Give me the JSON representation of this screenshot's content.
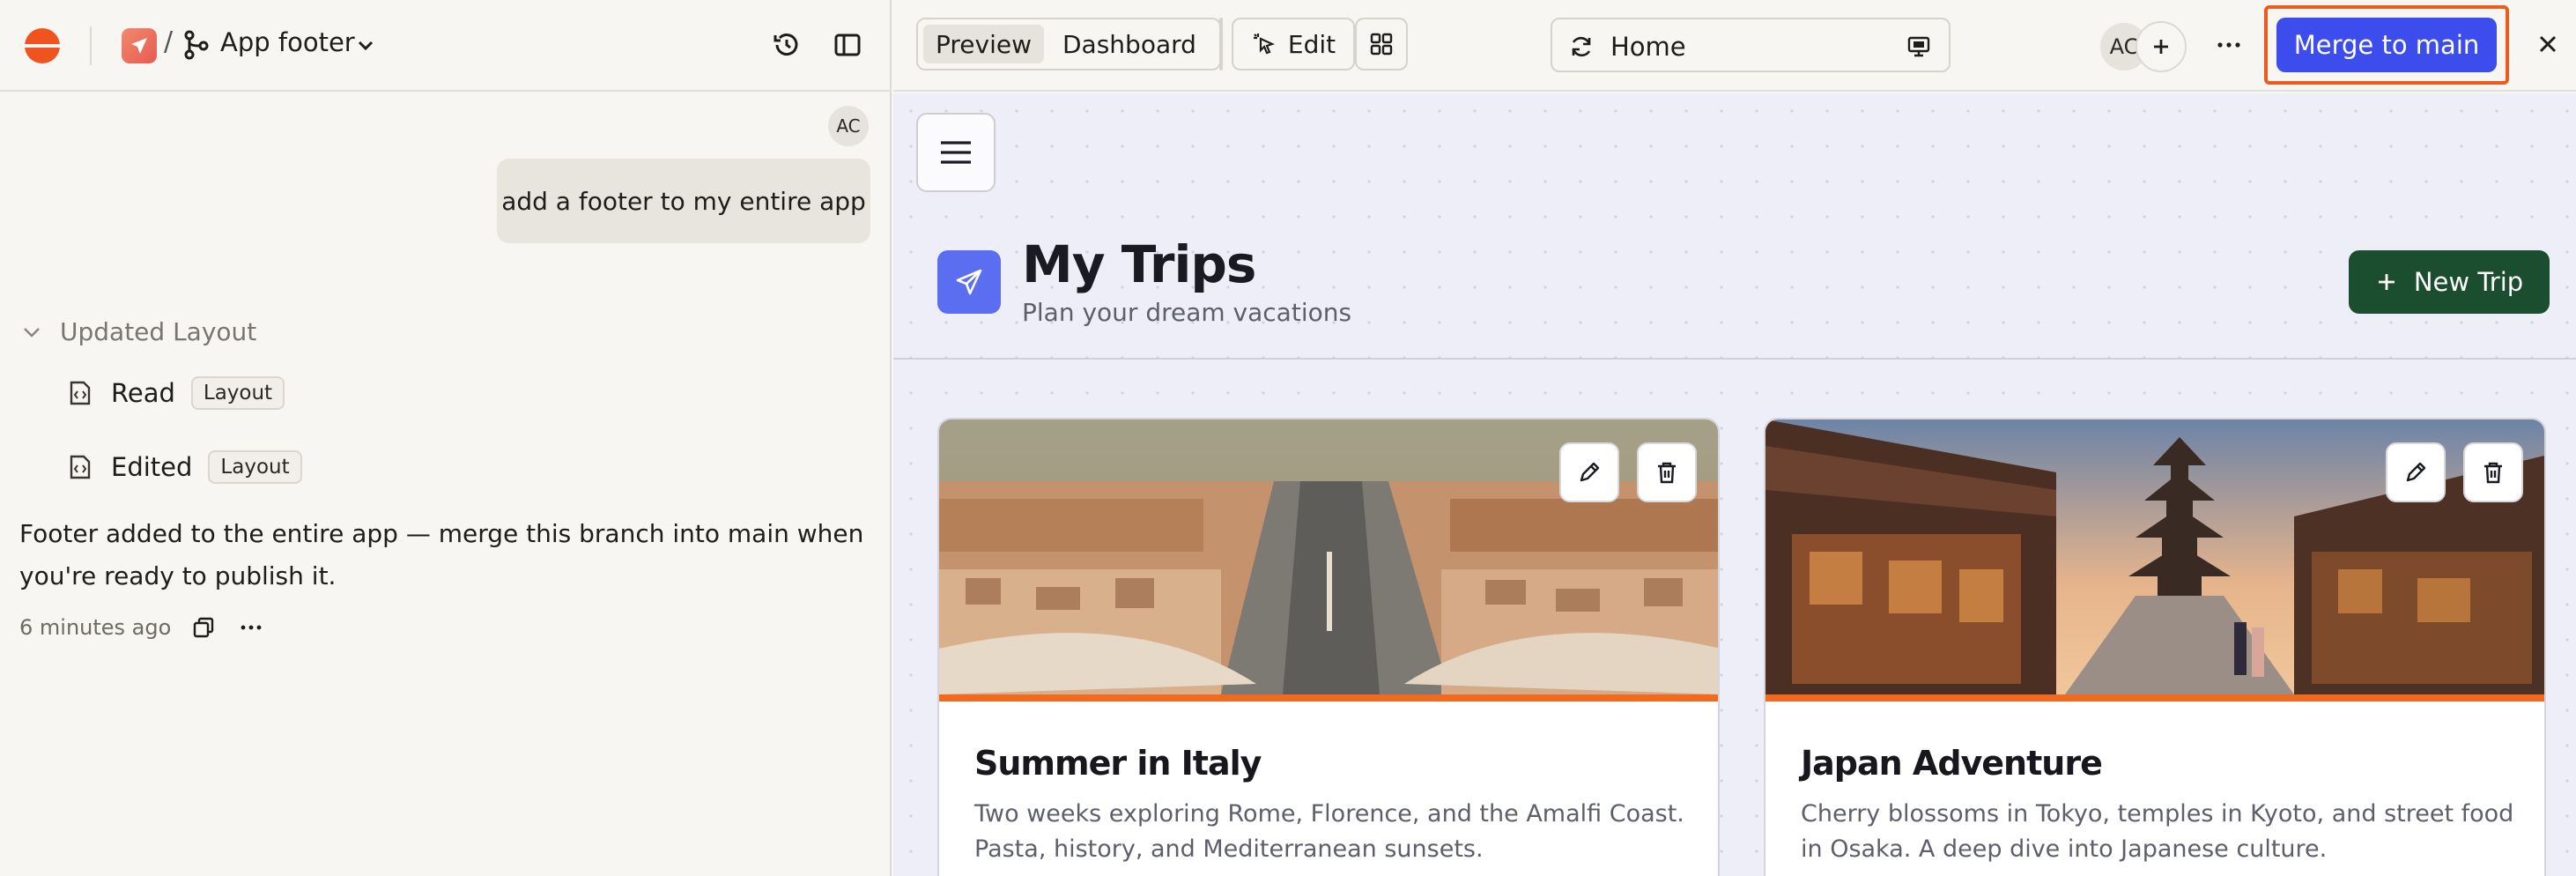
{
  "branch": {
    "name": "App footer"
  },
  "chat": {
    "user_avatar": "AC",
    "user_message": "add a footer to my entire app",
    "section_label": "Updated Layout",
    "tools": [
      {
        "action": "Read",
        "tag": "Layout"
      },
      {
        "action": "Edited",
        "tag": "Layout"
      }
    ],
    "reply": "Footer added to the entire app — merge this branch into main when you're ready to publish it.",
    "timestamp": "6 minutes ago"
  },
  "toolbar": {
    "preview_label": "Preview",
    "dashboard_label": "Dashboard",
    "edit_label": "Edit",
    "url_text": "Home",
    "collaborator_initials": "AC",
    "merge_label": "Merge to main"
  },
  "app": {
    "title": "My Trips",
    "subtitle": "Plan your dream vacations",
    "new_trip_label": "New Trip",
    "trips": [
      {
        "title": "Summer in Italy",
        "description": "Two weeks exploring Rome, Florence, and the Amalfi Coast. Pasta, history, and Mediterranean sunsets."
      },
      {
        "title": "Japan Adventure",
        "description": "Cherry blossoms in Tokyo, temples in Kyoto, and street food in Osaka. A deep dive into Japanese culture."
      }
    ]
  },
  "colors": {
    "accent": "#3d4cec",
    "brand": "#f1531f",
    "new_trip": "#1b4d2f",
    "highlight": "#ee5b1c"
  }
}
